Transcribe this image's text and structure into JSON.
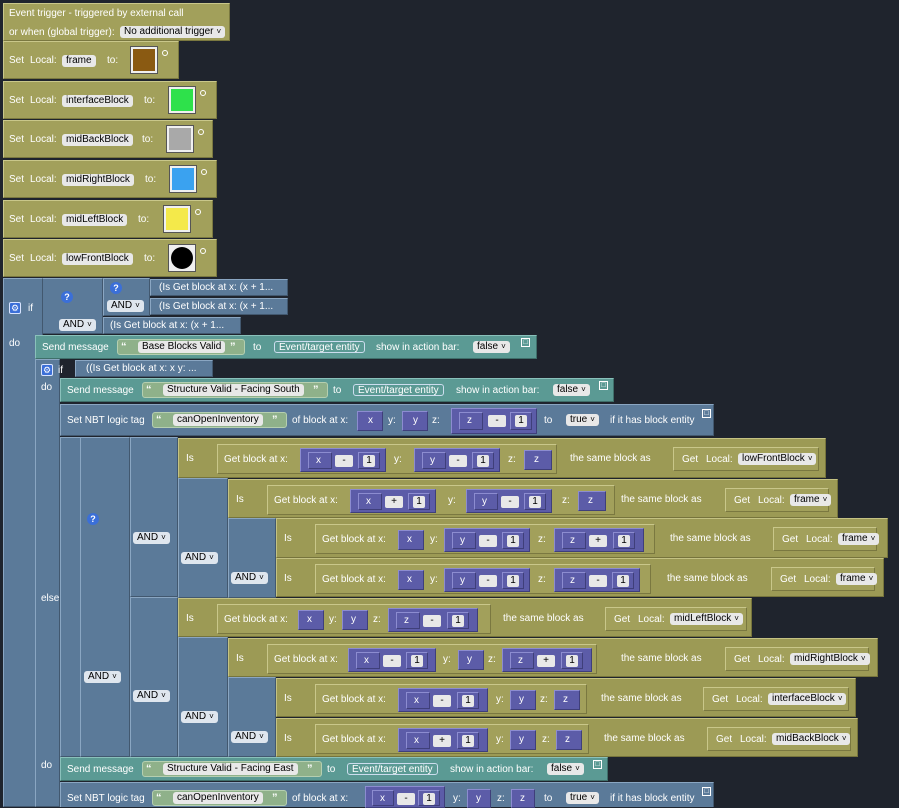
{
  "trigger": {
    "title": "Event trigger - triggered by external call",
    "global": "or when (global trigger):",
    "global_value": "No additional trigger"
  },
  "sets": [
    {
      "label": "Set",
      "local": "Local:",
      "name": "frame",
      "to": "to:",
      "color": "#8a5a12"
    },
    {
      "label": "Set",
      "local": "Local:",
      "name": "interfaceBlock",
      "to": "to:",
      "color": "#2ee14b"
    },
    {
      "label": "Set",
      "local": "Local:",
      "name": "midBackBlock",
      "to": "to:",
      "color": "#a9a9a9"
    },
    {
      "label": "Set",
      "local": "Local:",
      "name": "midRightBlock",
      "to": "to:",
      "color": "#3aa2f0"
    },
    {
      "label": "Set",
      "local": "Local:",
      "name": "midLeftBlock",
      "to": "to:",
      "color": "#f4e94a"
    },
    {
      "label": "Set",
      "local": "Local:",
      "name": "lowFrontBlock",
      "to": "to:",
      "color": "#000000"
    }
  ],
  "kw": {
    "if": "if",
    "do": "do",
    "else_if": "else if",
    "and": "AND",
    "is": "Is",
    "same": "the same block as",
    "get": "Get",
    "local": "Local:",
    "getblock": "Get block at x:",
    "y": "y:",
    "z": "z:",
    "x": "x",
    "yv": "y",
    "zv": "z",
    "one": "1",
    "minus": "-",
    "plus": "+"
  },
  "collapsed": {
    "c1": "(Is  Get block at x:  (x + 1...",
    "c2": "(Is  Get block at x:  (x + 1...",
    "c3": "(Is  Get block at x:  (x + 1...",
    "c4": "((Is  Get block at x:  x y:  ..."
  },
  "msg1": {
    "label": "Send message",
    "text": "Base Blocks Valid",
    "to": "to",
    "target": "Event/target entity",
    "bar": "show in action bar:",
    "value": "false"
  },
  "msg2": {
    "label": "Send message",
    "text": "Structure Valid - Facing South",
    "to": "to",
    "target": "Event/target entity",
    "bar": "show in action bar:",
    "value": "false"
  },
  "nbt1": {
    "label": "Set NBT logic tag",
    "tag": "canOpenInventory",
    "of": "of block at x:",
    "to": "to",
    "value": "true",
    "suffix": "if it has block entity"
  },
  "msg3": {
    "label": "Send message",
    "text": "Structure Valid - Facing East",
    "to": "to",
    "target": "Event/target entity",
    "bar": "show in action bar:",
    "value": "false"
  },
  "nbt2": {
    "label": "Set NBT logic tag",
    "tag": "canOpenInventory",
    "of": "of block at x:",
    "to": "to",
    "value": "true",
    "suffix": "if it has block entity"
  },
  "locals": {
    "l1": "lowFrontBlock",
    "l2": "frame",
    "l3": "frame",
    "l4": "frame",
    "l5": "midLeftBlock",
    "l6": "midRightBlock",
    "l7": "interfaceBlock",
    "l8": "midBackBlock"
  }
}
